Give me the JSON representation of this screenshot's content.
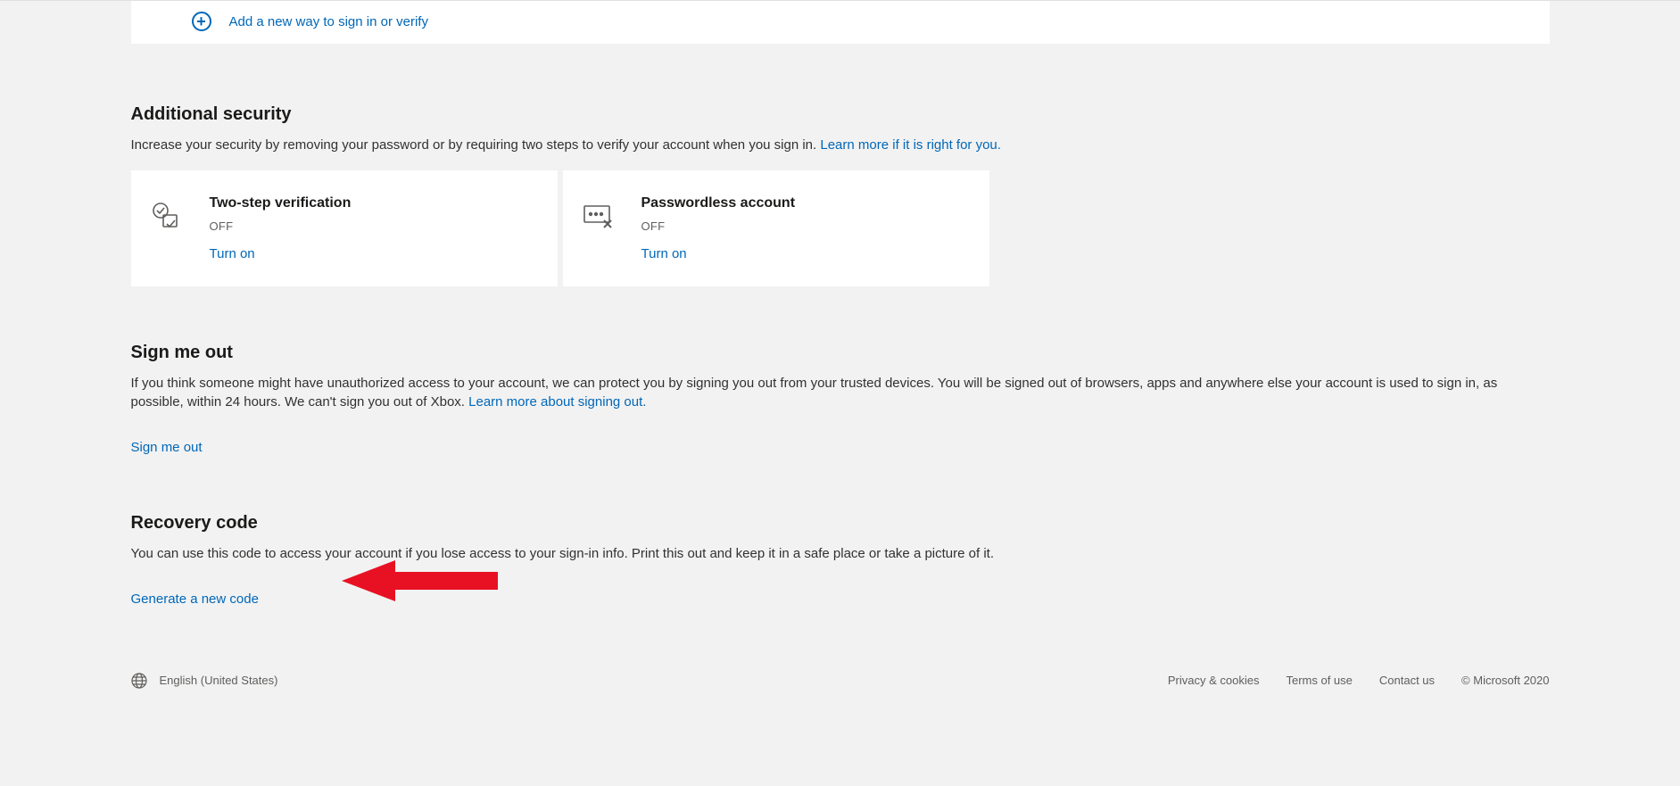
{
  "add_signin": {
    "label": "Add a new way to sign in or verify"
  },
  "additional_security": {
    "heading": "Additional security",
    "desc": "Increase your security by removing your password or by requiring two steps to verify your account when you sign in. ",
    "learn_more": "Learn more if it is right for you.",
    "two_step": {
      "title": "Two-step verification",
      "status": "OFF",
      "action": "Turn on"
    },
    "passwordless": {
      "title": "Passwordless account",
      "status": "OFF",
      "action": "Turn on"
    }
  },
  "sign_out": {
    "heading": "Sign me out",
    "desc": "If you think someone might have unauthorized access to your account, we can protect you by signing you out from your trusted devices. You will be signed out of browsers, apps and anywhere else your account is used to sign in, as possible, within 24 hours. We can't sign you out of Xbox. ",
    "learn_more": "Learn more about signing out.",
    "action": "Sign me out"
  },
  "recovery": {
    "heading": "Recovery code",
    "desc": "You can use this code to access your account if you lose access to your sign-in info. Print this out and keep it in a safe place or take a picture of it.",
    "action": "Generate a new code"
  },
  "footer": {
    "language": "English (United States)",
    "privacy": "Privacy & cookies",
    "terms": "Terms of use",
    "contact": "Contact us",
    "copyright": "© Microsoft 2020"
  }
}
